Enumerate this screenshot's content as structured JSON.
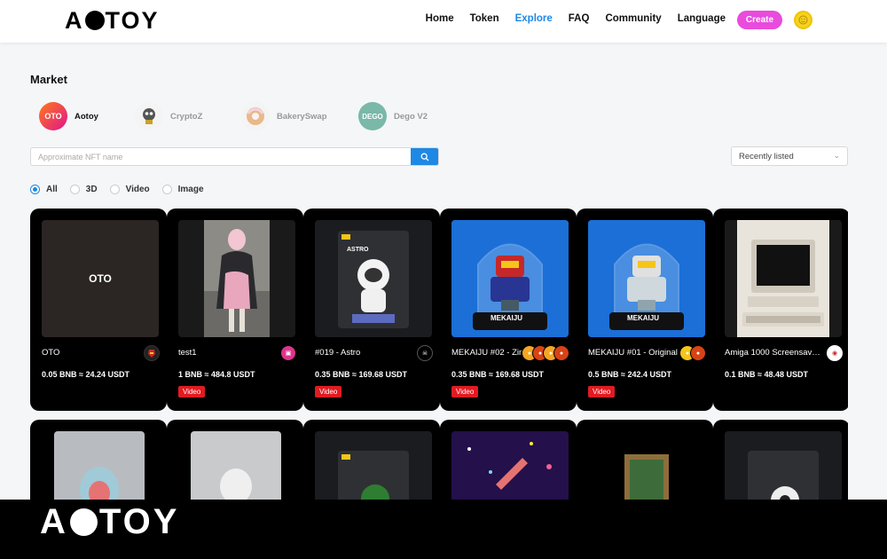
{
  "header": {
    "logo_left": "A",
    "logo_right": "TOY",
    "nav": [
      "Home",
      "Token",
      "Explore",
      "FAQ",
      "Community",
      "Language"
    ],
    "active_nav": "Explore",
    "create_label": "Create"
  },
  "market": {
    "title": "Market",
    "collections": [
      {
        "label": "Aotoy",
        "icon": "OTO",
        "selected": true
      },
      {
        "label": "CryptoZ",
        "icon": "",
        "selected": false
      },
      {
        "label": "BakerySwap",
        "icon": "",
        "selected": false
      },
      {
        "label": "Dego V2",
        "icon": "DEGO",
        "selected": false
      }
    ],
    "search_placeholder": "Approximate NFT name",
    "sort_value": "Recently listed",
    "filters": [
      "All",
      "3D",
      "Video",
      "Image"
    ],
    "selected_filter": "All"
  },
  "cards": [
    {
      "name": "OTO",
      "price": "0.05 BNB ≈ 24.24 USDT",
      "tag": "",
      "thumb_text": "OTO"
    },
    {
      "name": "test1",
      "price": "1 BNB ≈ 484.8 USDT",
      "tag": "Video",
      "thumb_text": ""
    },
    {
      "name": "#019 - Astro",
      "price": "0.35 BNB ≈ 169.68 USDT",
      "tag": "Video",
      "thumb_text": "ASTRO"
    },
    {
      "name": "MEKAIJU #02 - Zinger",
      "price": "0.35 BNB ≈ 169.68 USDT",
      "tag": "Video",
      "thumb_text": "MEKAIJU"
    },
    {
      "name": "MEKAIJU #01 - Original",
      "price": "0.5 BNB ≈ 242.4 USDT",
      "tag": "Video",
      "thumb_text": "MEKAIJU"
    },
    {
      "name": "Amiga 1000 Screensaver...",
      "price": "0.1 BNB ≈ 48.48 USDT",
      "tag": "",
      "thumb_text": ""
    }
  ],
  "footer_logo_left": "A",
  "footer_logo_right": "TOY"
}
